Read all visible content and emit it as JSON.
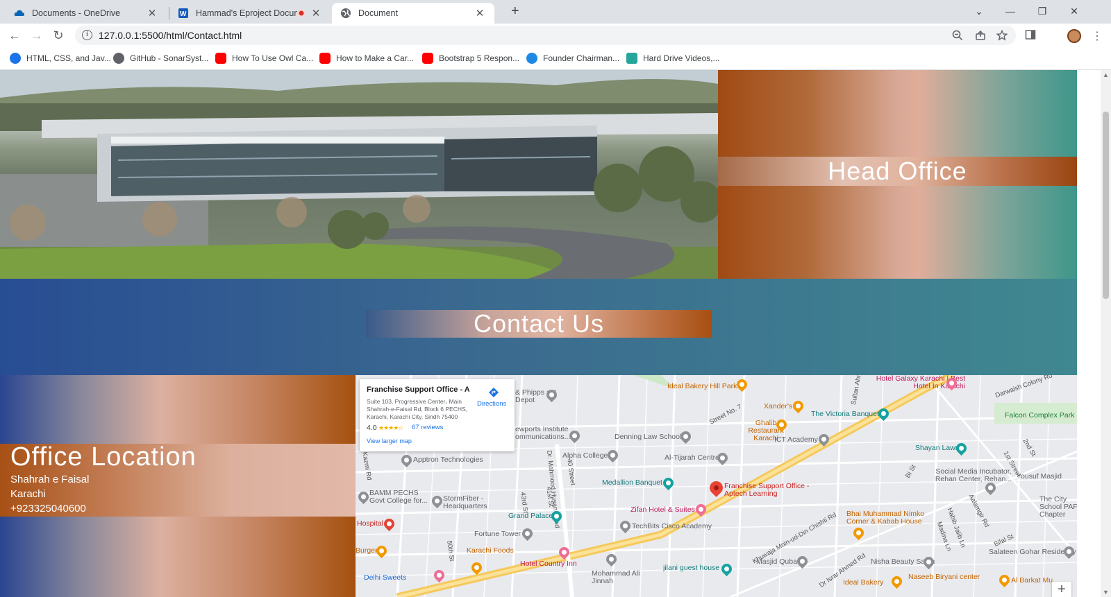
{
  "browser": {
    "tabs": [
      {
        "title": "Documents - OneDrive",
        "close": "✕"
      },
      {
        "title": "Hammad's Eproject Docume",
        "close": "✕"
      },
      {
        "title": "Document",
        "close": "✕"
      }
    ],
    "new_tab": "+",
    "window_controls": {
      "dropdown": "⌄",
      "minimize": "—",
      "restore": "❐",
      "close": "✕"
    },
    "url": "127.0.0.1:5500/html/Contact.html",
    "bookmarks": [
      {
        "label": "HTML, CSS, and Jav...",
        "color": "#1a73e8"
      },
      {
        "label": "GitHub - SonarSyst...",
        "color": "#5f6368"
      },
      {
        "label": "How To Use Owl Ca...",
        "color": "#ff0000"
      },
      {
        "label": "How to Make a Car...",
        "color": "#ff0000"
      },
      {
        "label": "Bootstrap 5 Respon...",
        "color": "#ff0000"
      },
      {
        "label": "Founder Chairman...",
        "color": "#1e88e5"
      },
      {
        "label": "Hard Drive Videos,...",
        "color": "#26a69a"
      }
    ]
  },
  "page": {
    "head_office_title": "Head Office",
    "contact_title": "Contact Us",
    "office": {
      "title": "Office Location",
      "street": "Shahrah e Faisal",
      "city": "Karachi",
      "phone": "+923325040600"
    }
  },
  "map": {
    "card": {
      "name": "Franchise Support Office - Apt...",
      "address": "Suite 103, Progressive Center، Main Shahrah-e-Faisal Rd, Block 6 PECHS, Karachi, Karachi City, Sindh 75400",
      "rating": "4.0",
      "stars": "★★★★☆",
      "reviews": "67 reviews",
      "larger_map": "View larger map",
      "directions": "Directions"
    },
    "main_place": "Franchise Support Office - Aptech Learning",
    "places": [
      {
        "label": "Apptron Technologies",
        "style": "grey"
      },
      {
        "label": "BAMM PECHS Govt College for...",
        "style": "grey"
      },
      {
        "label": "StormFiber - Headquarters",
        "style": "grey"
      },
      {
        "label": "Grand Palace",
        "style": "teal"
      },
      {
        "label": "Fortune Tower",
        "style": "grey"
      },
      {
        "label": "Karachi Foods",
        "style": "orange"
      },
      {
        "label": "Hotel Country Inn",
        "style": "pink"
      },
      {
        "label": "Hospital",
        "style": "red"
      },
      {
        "label": "Burger",
        "style": "orange"
      },
      {
        "label": "Delhi Sweets",
        "style": "blue"
      },
      {
        "label": "Alpha College",
        "style": "grey"
      },
      {
        "label": "Medallion Banquet",
        "style": "teal"
      },
      {
        "label": "Zifan Hotel & Suites",
        "style": "pink"
      },
      {
        "label": "TechBits Cisco Academy",
        "style": "grey"
      },
      {
        "label": "Mohammad Ali Jinnah",
        "style": "grey"
      },
      {
        "label": "Denning Law School",
        "style": "grey"
      },
      {
        "label": "Al-Tijarah Centre",
        "style": "grey"
      },
      {
        "label": "Ideal Bakery Hill Park",
        "style": "orange"
      },
      {
        "label": "Xander's",
        "style": "orange"
      },
      {
        "label": "Ghalib Restaurant Karachi",
        "style": "orange"
      },
      {
        "label": "ICT Academy",
        "style": "grey"
      },
      {
        "label": "The Victoria Banquet",
        "style": "teal"
      },
      {
        "label": "Hotel Galaxy Karachi | Best Hotel In Karachi",
        "style": "pink"
      },
      {
        "label": "Shayan Lawn",
        "style": "teal"
      },
      {
        "label": "Falcon Complex Park",
        "style": "green"
      },
      {
        "label": "Social Media Incubator, Rehan Center, Rehan...",
        "style": "grey"
      },
      {
        "label": "Yousuf Masjid",
        "style": "grey"
      },
      {
        "label": "The City School PAF Chapter",
        "style": "grey"
      },
      {
        "label": "Bhai Muhammad Nimko Corner & Kabab House",
        "style": "orange"
      },
      {
        "label": "Salateen Gohar Residency",
        "style": "grey"
      },
      {
        "label": "Nisha Beauty Salon",
        "style": "grey"
      },
      {
        "label": "Masjid Quba",
        "style": "grey"
      },
      {
        "label": "jilani guest house",
        "style": "teal"
      },
      {
        "label": "Naseeb Biryani center",
        "style": "orange"
      },
      {
        "label": "Al Barkat Mu...",
        "style": "orange"
      },
      {
        "label": "Ideal Bakery",
        "style": "orange"
      },
      {
        "label": "& Phipps ast Depot",
        "style": "grey"
      },
      {
        "label": "ewports Institute ommunications...",
        "style": "grey"
      }
    ],
    "roads": [
      "Dr. Mahmood Husan Road",
      "Khuwaja Moin-ud-Din Chishti Rd",
      "Darwaish Colony Rd",
      "Street No. 7",
      "Sultan Ahmed Rd",
      "Dr Israr Ahmed Rd",
      "Kazmi Rd",
      "41st St",
      "43rd St",
      "40 Street",
      "50th St",
      "2nd St",
      "1st Street",
      "Habib Jalib Ln",
      "Madina Ln",
      "Bilal St",
      "Bi St",
      "Aalamgir Rd"
    ],
    "zoom_in": "+"
  }
}
